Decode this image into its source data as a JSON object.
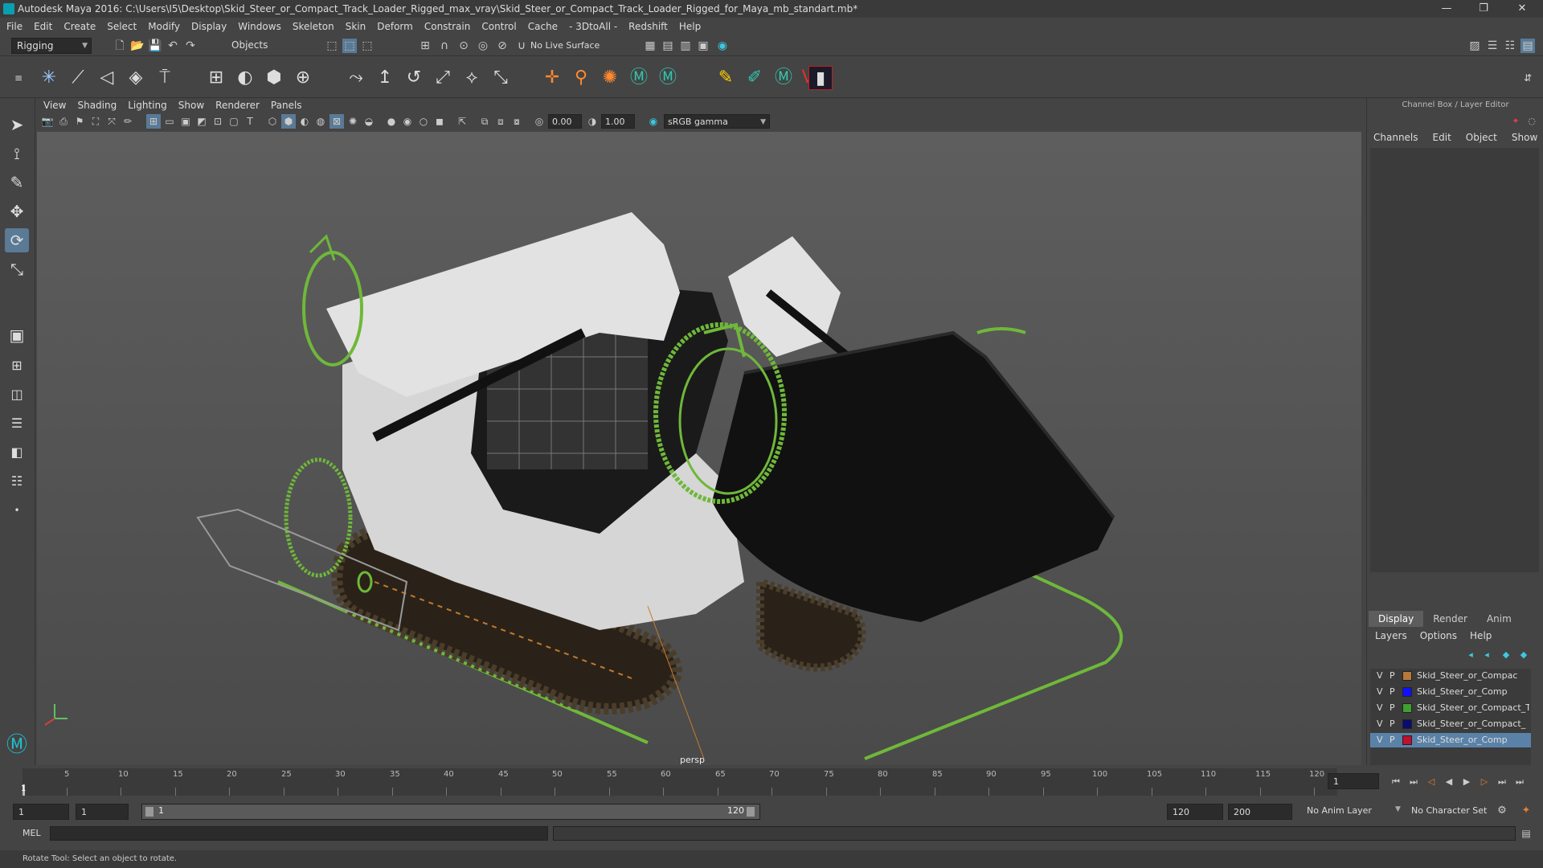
{
  "window": {
    "title": "Autodesk Maya 2016: C:\\Users\\I5\\Desktop\\Skid_Steer_or_Compact_Track_Loader_Rigged_max_vray\\Skid_Steer_or_Compact_Track_Loader_Rigged_for_Maya_mb_standart.mb*",
    "minimize": "—",
    "restore": "❐",
    "close": "✕"
  },
  "menubar": [
    "File",
    "Edit",
    "Create",
    "Select",
    "Modify",
    "Display",
    "Windows",
    "Skeleton",
    "Skin",
    "Deform",
    "Constrain",
    "Control",
    "Cache",
    "- 3DtoAll -",
    "Redshift",
    "Help"
  ],
  "statusline": {
    "menuset": "Rigging",
    "selection_mode": "Objects",
    "live_surface": "No Live Surface"
  },
  "viewport": {
    "menus": [
      "View",
      "Shading",
      "Lighting",
      "Show",
      "Renderer",
      "Panels"
    ],
    "exposure": "0.00",
    "gamma": "1.00",
    "colorspace": "sRGB gamma",
    "camera": "persp"
  },
  "channelbox": {
    "title": "Channel Box / Layer Editor",
    "menus": [
      "Channels",
      "Edit",
      "Object",
      "Show"
    ],
    "layer_tabs": [
      "Display",
      "Render",
      "Anim"
    ],
    "layer_menus": [
      "Layers",
      "Options",
      "Help"
    ],
    "layers": [
      {
        "v": "V",
        "p": "P",
        "color": "#b87a3a",
        "name": "Skid_Steer_or_Compac"
      },
      {
        "v": "V",
        "p": "P",
        "color": "#1010ff",
        "name": "Skid_Steer_or_Comp"
      },
      {
        "v": "V",
        "p": "P",
        "color": "#3fa030",
        "name": "Skid_Steer_or_Compact_Tr"
      },
      {
        "v": "V",
        "p": "P",
        "color": "#0a0a70",
        "name": "Skid_Steer_or_Compact_"
      },
      {
        "v": "V",
        "p": "P",
        "color": "#c01030",
        "name": "Skid_Steer_or_Comp"
      }
    ]
  },
  "timeslider": {
    "ticks": [
      "5",
      "10",
      "15",
      "20",
      "25",
      "30",
      "35",
      "40",
      "45",
      "50",
      "55",
      "60",
      "65",
      "70",
      "75",
      "80",
      "85",
      "90",
      "95",
      "100",
      "105",
      "110",
      "115",
      "120"
    ],
    "current_frame": "1",
    "current_field": "1"
  },
  "rangeslider": {
    "start": "1",
    "range_start": "1",
    "range_bar_start": "1",
    "range_bar_end": "120",
    "range_end": "120",
    "end": "200",
    "anim_layer": "No Anim Layer",
    "character_set": "No Character Set"
  },
  "cmdline": {
    "language": "MEL"
  },
  "helpline": {
    "text": "Rotate Tool: Select an object to rotate."
  }
}
